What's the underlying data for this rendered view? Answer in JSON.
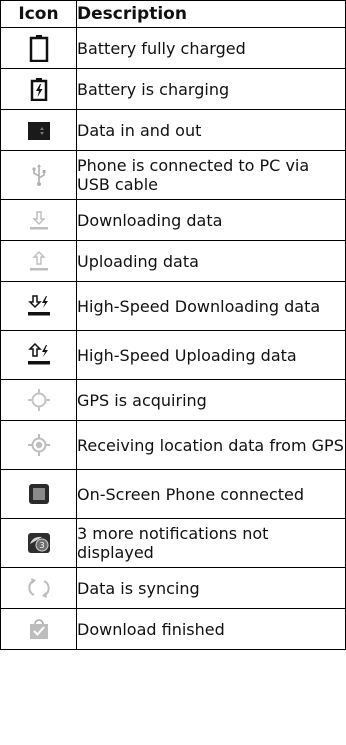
{
  "table": {
    "header": {
      "icon": "Icon",
      "description": "Description"
    },
    "rows": [
      {
        "icon": "battery-full-icon",
        "description": "Battery fully charged"
      },
      {
        "icon": "battery-charging-icon",
        "description": "Battery is charging"
      },
      {
        "icon": "data-in-out-icon",
        "description": "Data in and out"
      },
      {
        "icon": "usb-icon",
        "description": "Phone is connected to PC via USB cable"
      },
      {
        "icon": "download-icon",
        "description": "Downloading data"
      },
      {
        "icon": "upload-icon",
        "description": "Uploading data"
      },
      {
        "icon": "high-speed-download-icon",
        "description": "High-Speed Downloading data"
      },
      {
        "icon": "high-speed-upload-icon",
        "description": "High-Speed Uploading data"
      },
      {
        "icon": "gps-acquiring-icon",
        "description": "GPS is acquiring"
      },
      {
        "icon": "gps-receiving-icon",
        "description": "Receiving location data from GPS"
      },
      {
        "icon": "on-screen-phone-icon",
        "description": "On-Screen Phone connected"
      },
      {
        "icon": "more-notifications-icon",
        "badge": "3",
        "description": "3 more notifications not displayed"
      },
      {
        "icon": "sync-icon",
        "description": "Data is syncing"
      },
      {
        "icon": "download-finished-icon",
        "description": "Download finished"
      }
    ]
  },
  "colors": {
    "border": "#000000",
    "icon_gray": "#bdbdbd",
    "icon_dark": "#1a1a1a"
  }
}
